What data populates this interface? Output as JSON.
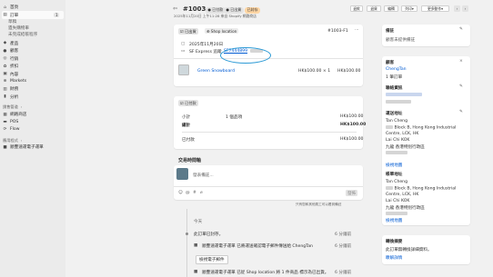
{
  "sidebar": {
    "home": "首頁",
    "orders": "訂單",
    "orders_count": "1",
    "orders_sub": [
      "草稿",
      "遺失購物車",
      "未完成結帳程序"
    ],
    "products": "產品",
    "customers": "顧客",
    "marketing": "行銷",
    "discounts": "折扣",
    "content": "內容",
    "markets": "Markets",
    "finance": "財務",
    "analytics": "分析",
    "sales_channels": "銷售管道",
    "online_store": "網路商店",
    "pos": "POS",
    "flow": "Flow",
    "apps_section": "應用程式",
    "app_item": "順豐速運電子運單"
  },
  "header": {
    "order_number": "#1003",
    "badge_paid": "已付款",
    "badge_fulfilled": "已出貨",
    "badge_archived": "已封存",
    "subtitle": "2025年11月20日 上午11:28 來自 Shopify 網路商店",
    "btn_refund": "退款",
    "btn_return": "退貨",
    "btn_edit": "編輯",
    "btn_print": "列印",
    "btn_more": "更多動作"
  },
  "fulfilled_card": {
    "status": "已出貨",
    "location": "Shop location",
    "fulfillment_id": "#1003-F1",
    "date": "2025年11月20日",
    "carrier": "SF Express 追蹤",
    "tracking": "SF7444899",
    "product": "Green Snowboard",
    "unit_price": "HK$100.00 × 1",
    "line_total": "HK$100.00"
  },
  "payment_card": {
    "status": "已付款",
    "rows": [
      {
        "label": "小計",
        "mid": "1 個品項",
        "value": "HK$100.00"
      },
      {
        "label": "總計",
        "mid": "",
        "value": "HK$100.00"
      },
      {
        "label": "已付款",
        "mid": "",
        "value": "HK$100.00"
      }
    ]
  },
  "timeline": {
    "title": "交易時間軸",
    "placeholder": "發表備註...",
    "post_button": "發佈",
    "note": "只有您和其他員工可以看到備註",
    "date_label": "今天",
    "events": [
      {
        "text": "此訂單已封存。",
        "time": "6 分鐘前"
      },
      {
        "text": "順豐速運電子運單 已將運送確認電子郵件傳送給 ChengTan",
        "time": "6 分鐘前",
        "button": "檢視電子郵件"
      },
      {
        "text": "順豐速運電子運單 已從 Shop location 將 1 件商品 標示為已出貨。",
        "time": "6 分鐘前"
      }
    ]
  },
  "notes_card": {
    "title": "備註",
    "empty": "顧客未提供備註"
  },
  "customer_card": {
    "title": "顧客",
    "name": "ChengTan",
    "orders": "1 筆訂單",
    "contact_title": "聯絡資訊",
    "shipping_title": "運送地址",
    "ship_lines": [
      "Tan Cheng",
      "Block B, Hong Kong Industrial",
      "Centre, LCK, HK",
      "Lai Chi KOK",
      "九龍 香港特別行政區"
    ],
    "ship_link": "檢視地圖",
    "billing_title": "帳單地址",
    "bill_lines": [
      "Tan Cheng",
      "Block B, Hong Kong Industrial",
      "Centre, LCK, HK",
      "Lai Chi KOK",
      "九龍 香港特別行政區"
    ],
    "bill_link": "檢視地圖"
  },
  "conversion_card": {
    "title": "轉換摘要",
    "desc": "此訂單無轉換詳細資料。",
    "link": "瞭解詳情"
  },
  "colors": {
    "accent": "#005bd3",
    "highlight": "#2e9bd6",
    "sidebar": "#ebebeb",
    "bg": "#f1f1f1"
  }
}
